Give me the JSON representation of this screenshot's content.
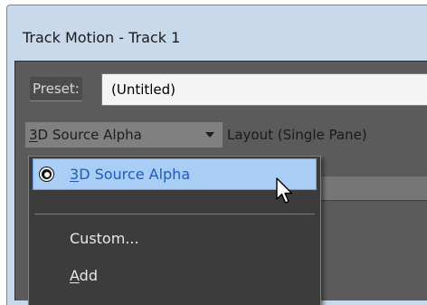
{
  "window": {
    "title": "Track Motion - Track 1"
  },
  "preset": {
    "label": "Preset:",
    "value": "(Untitled)"
  },
  "toolbar": {
    "mode_select": {
      "hotkey": "3",
      "rest": "D Source Alpha"
    },
    "layout_select": "Layout (Single Pane)"
  },
  "menu": {
    "selected": {
      "hotkey": "3",
      "rest": "D Source Alpha"
    },
    "items": [
      {
        "label": "Custom..."
      },
      {
        "hotkey": "A",
        "rest": "dd"
      }
    ]
  },
  "colors": {
    "accent": "#a9cdf4",
    "selected_text": "#1f5cba",
    "menu_background": "#3c3c3c"
  },
  "icons": {
    "radio": "radio-selected-icon",
    "cursor": "mouse-pointer-icon"
  }
}
